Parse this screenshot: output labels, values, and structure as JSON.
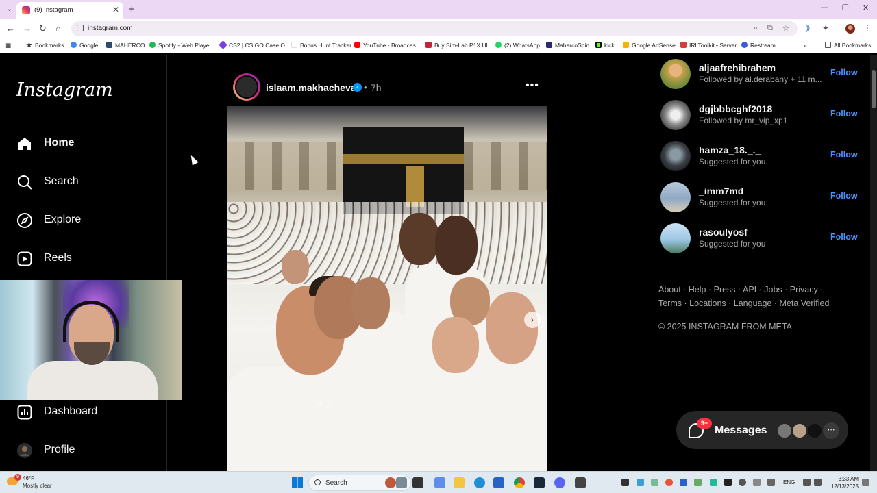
{
  "browser": {
    "tab_title": "(9) Instagram",
    "url": "instagram.com",
    "bookmarks": [
      {
        "label": "Bookmarks",
        "color": "#333333"
      },
      {
        "label": "Google",
        "color": "#4285f4"
      },
      {
        "label": "MAHERCO",
        "color": "#2e4a6e"
      },
      {
        "label": "Spotify - Web Playe...",
        "color": "#1db954"
      },
      {
        "label": "CS2 | CS:GO Case O...",
        "color": "#7b3fe4"
      },
      {
        "label": "Bonus Hunt Tracker",
        "color": "#ffffff"
      },
      {
        "label": "YouTube - Broadcas...",
        "color": "#ff0000"
      },
      {
        "label": "Buy Sim-Lab P1X Ul...",
        "color": "#c0263a"
      },
      {
        "label": "(2) WhatsApp",
        "color": "#25d366"
      },
      {
        "label": "MahercoSpin",
        "color": "#2a2a6e"
      },
      {
        "label": "kick",
        "color": "#111111"
      },
      {
        "label": "Google AdSense",
        "color": "#f4b400"
      },
      {
        "label": "IRLToolkit • Server",
        "color": "#d33f3f"
      },
      {
        "label": "Restream",
        "color": "#3b5bdb"
      }
    ],
    "all_bookmarks": "All Bookmarks"
  },
  "instagram": {
    "logo": "Instagram",
    "nav": {
      "home": "Home",
      "search": "Search",
      "explore": "Explore",
      "reels": "Reels",
      "dashboard": "Dashboard",
      "profile": "Profile"
    },
    "post": {
      "username": "islaam.makhacheva",
      "separator": "•",
      "time": "7h",
      "watermark": "_ui_0"
    },
    "suggestions": [
      {
        "username": "aljaafrehibrahem",
        "subtitle": "Followed by al.derabany + 11 m...",
        "follow": "Follow",
        "avatar_color": "#c9a24a"
      },
      {
        "username": "dgjbbbcghf2018",
        "subtitle": "Followed by mr_vip_xp1",
        "follow": "Follow",
        "avatar_color": "#8e8e8e"
      },
      {
        "username": "hamza_18._._",
        "subtitle": "Suggested for you",
        "follow": "Follow",
        "avatar_color": "#3a3f44"
      },
      {
        "username": "_imm7md",
        "subtitle": "Suggested for you",
        "follow": "Follow",
        "avatar_color": "#8fa9c4"
      },
      {
        "username": "rasoulyosf",
        "subtitle": "Suggested for you",
        "follow": "Follow",
        "avatar_color": "#9cc6e6"
      }
    ],
    "footer": {
      "links": [
        "About",
        "Help",
        "Press",
        "API",
        "Jobs",
        "Privacy",
        "Terms",
        "Locations",
        "Language",
        "Meta Verified"
      ],
      "copyright": "© 2025 INSTAGRAM FROM META"
    },
    "messages": {
      "label": "Messages",
      "badge": "9+"
    }
  },
  "taskbar": {
    "temperature": "46°F",
    "condition": "Mostly clear",
    "weather_badge": "9",
    "search": "Search",
    "language": "ENG",
    "time": "3:33 AM",
    "date": "12/13/2025"
  }
}
